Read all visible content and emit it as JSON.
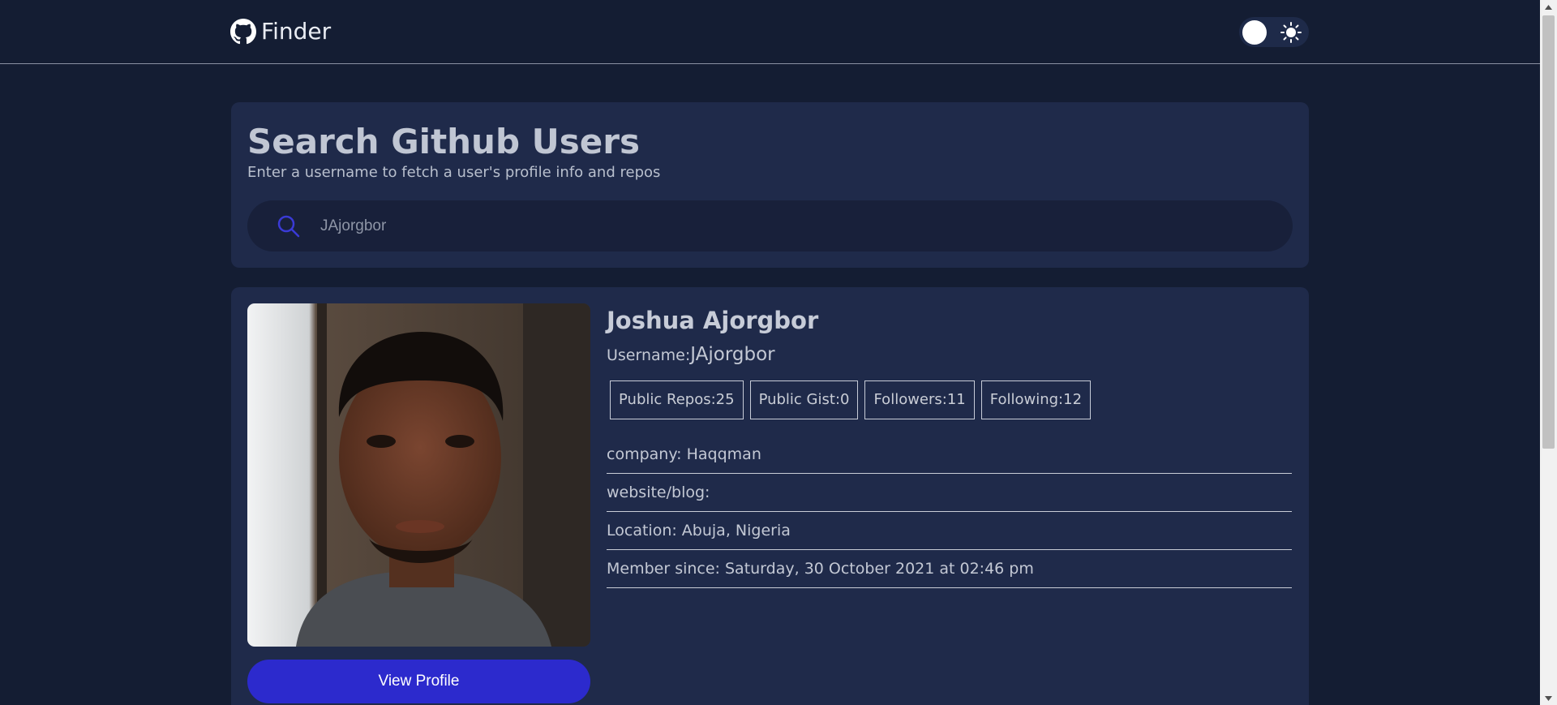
{
  "header": {
    "brand": "Finder",
    "toggle_state": "dark"
  },
  "search": {
    "title": "Search Github Users",
    "subtitle": "Enter a username to fetch a user's profile info and repos",
    "input_value": "JAjorgbor"
  },
  "profile": {
    "name": "Joshua Ajorgbor",
    "username_label": "Username:",
    "username": "JAjorgbor",
    "stats": [
      "Public Repos:25",
      "Public Gist:0",
      "Followers:11",
      "Following:12"
    ],
    "details": [
      "company: Haqqman",
      "website/blog:",
      "Location: Abuja, Nigeria",
      "Member since: Saturday, 30 October 2021 at 02:46 pm"
    ],
    "view_profile_label": "View Profile"
  },
  "colors": {
    "background": "#141d33",
    "card": "#1f2a4a",
    "accent": "#2c2acd",
    "search_icon": "#3a3ad6"
  },
  "icons": {
    "brand": "github-icon",
    "theme": "sun-icon",
    "search": "search-icon"
  }
}
